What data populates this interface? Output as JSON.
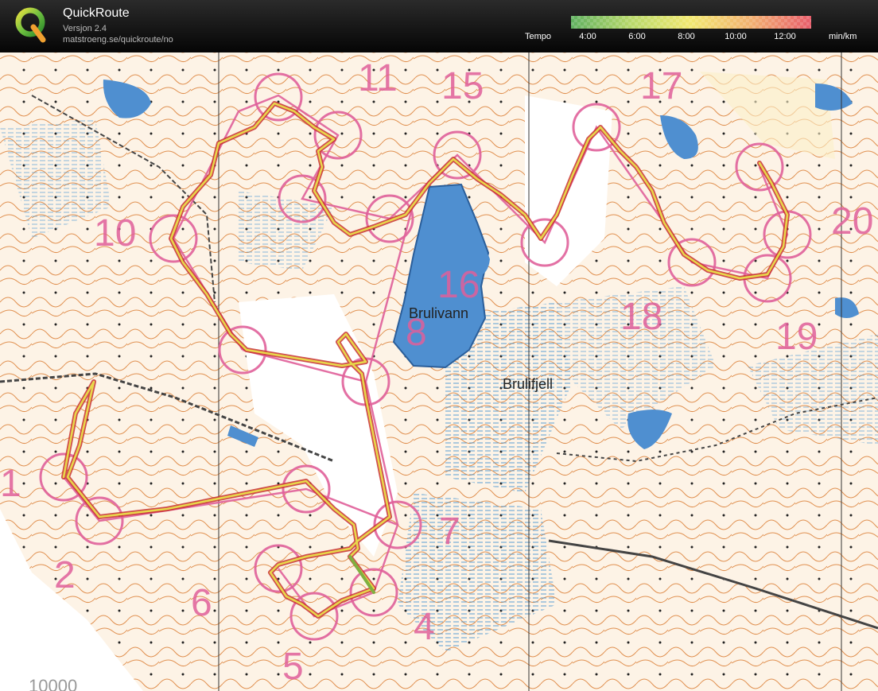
{
  "header": {
    "app_name": "QuickRoute",
    "version": "Versjon 2.4",
    "url": "matstroeng.se/quickroute/no",
    "logo_letter": "Q"
  },
  "legend": {
    "label": "Tempo",
    "unit": "min/km",
    "ticks": [
      "4:00",
      "6:00",
      "8:00",
      "10:00",
      "12:00"
    ],
    "colors": [
      "#5fb05f",
      "#b8d86a",
      "#f2e870",
      "#f2b070",
      "#e85c6a"
    ]
  },
  "map": {
    "lake_name": "Brulivann",
    "place_name": "Brulifjell",
    "scale_text": "10000",
    "control_numbers": [
      "1",
      "2",
      "4",
      "5",
      "6",
      "7",
      "8",
      "10",
      "11",
      "15",
      "16",
      "17",
      "18",
      "19",
      "20"
    ],
    "course_color": "#e0609a",
    "route_colors": [
      "#e8d84a",
      "#c83030",
      "#80b040"
    ]
  }
}
